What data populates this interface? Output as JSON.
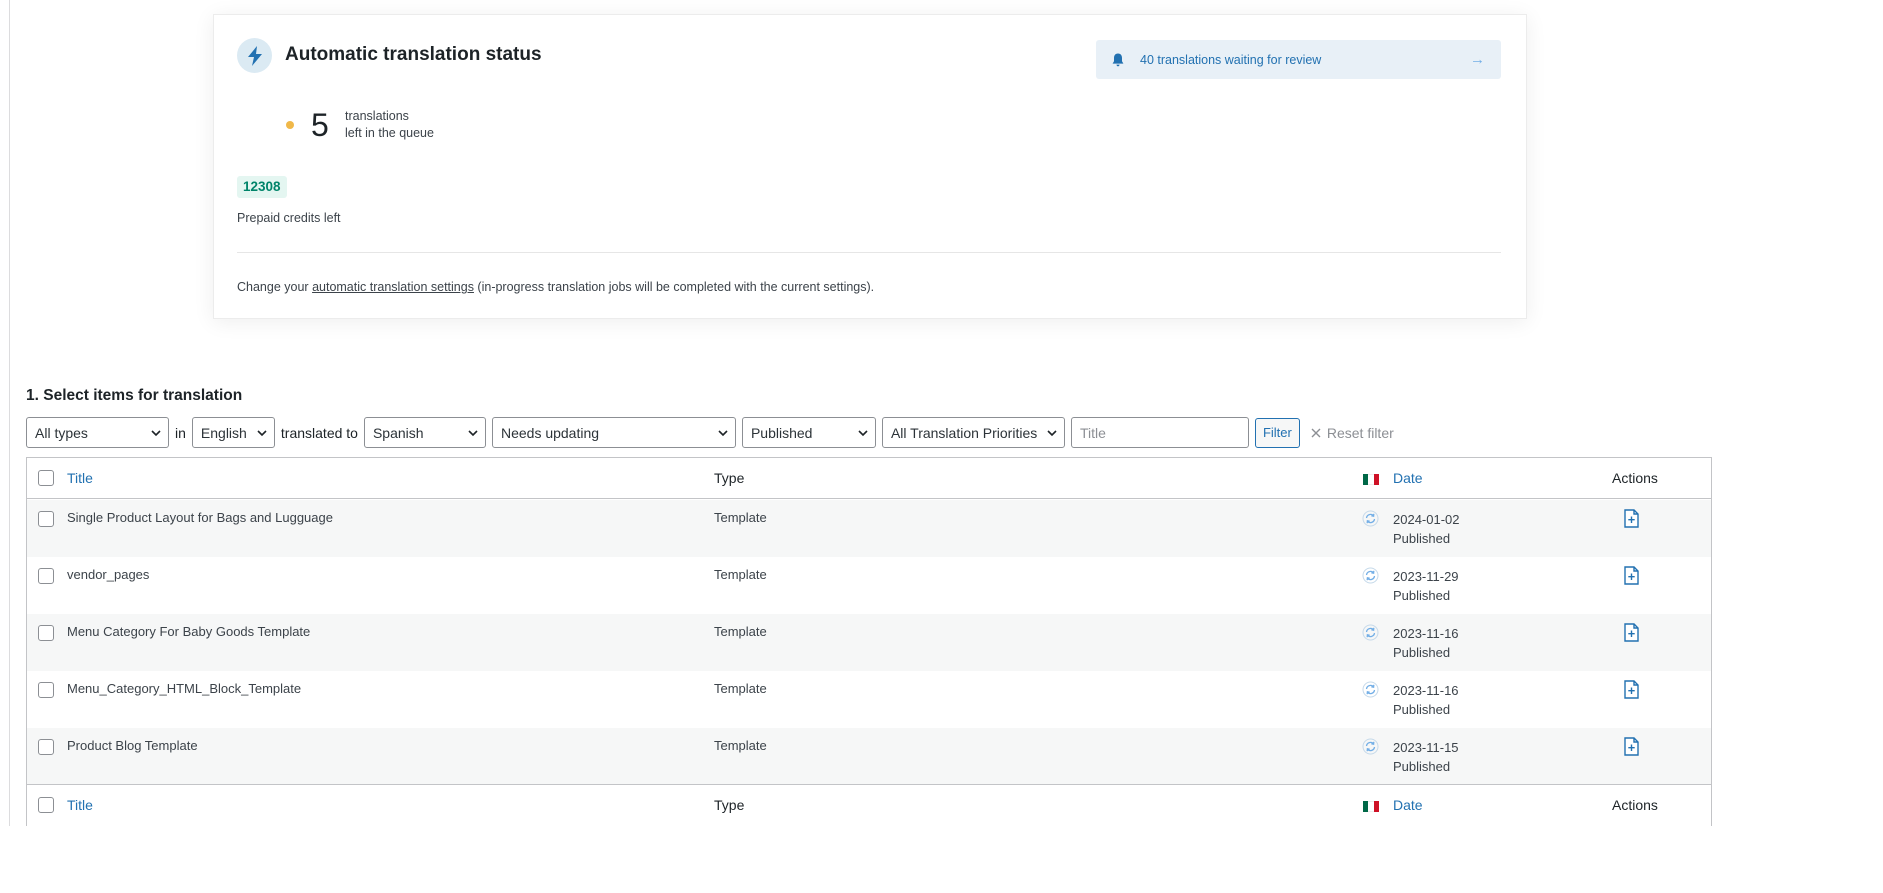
{
  "status_card": {
    "title": "Automatic translation status",
    "review_banner": "40 translations waiting for review",
    "queue_count": "5",
    "queue_line1": "translations",
    "queue_line2": "left in the queue",
    "credits": "12308",
    "credits_label": "Prepaid credits left",
    "settings_prefix": "Change your ",
    "settings_link": "automatic translation settings",
    "settings_suffix": " (in-progress translation jobs will be completed with the current settings)."
  },
  "section": {
    "title": "1. Select items for translation"
  },
  "filters": {
    "type": "All types",
    "in_label": "in",
    "source_language": "English",
    "translated_to_label": "translated to",
    "target_language": "Spanish",
    "status": "Needs updating",
    "publish_status": "Published",
    "priority": "All Translation Priorities",
    "title_placeholder": "Title",
    "filter_button": "Filter",
    "reset": "Reset filter"
  },
  "table": {
    "headers": {
      "title": "Title",
      "type": "Type",
      "date": "Date",
      "actions": "Actions"
    },
    "rows": [
      {
        "title": "Single Product Layout for Bags and Lugguage",
        "type": "Template",
        "date": "2024-01-02",
        "status": "Published"
      },
      {
        "title": "vendor_pages",
        "type": "Template",
        "date": "2023-11-29",
        "status": "Published"
      },
      {
        "title": "Menu Category For Baby Goods Template",
        "type": "Template",
        "date": "2023-11-16",
        "status": "Published"
      },
      {
        "title": "Menu_Category_HTML_Block_Template",
        "type": "Template",
        "date": "2023-11-16",
        "status": "Published"
      },
      {
        "title": "Product Blog Template",
        "type": "Template",
        "date": "2023-11-15",
        "status": "Published"
      }
    ]
  },
  "colors": {
    "link": "#2271b1",
    "queue_dot": "#f0b849",
    "credits_text": "#00846a",
    "credits_bg": "#e4f6f1",
    "banner_bg": "#e8f0f7",
    "mexico_flag": [
      "#006847",
      "#ffffff",
      "#ce1126"
    ]
  },
  "icons": {
    "status": "lightning-icon",
    "banner": "bell-icon",
    "banner_arrow": "arrow-right-icon",
    "row_status": "sync-needs-update-icon",
    "row_action": "add-translation-document-icon",
    "reset": "close-icon",
    "flag": "mexico-flag-icon"
  }
}
